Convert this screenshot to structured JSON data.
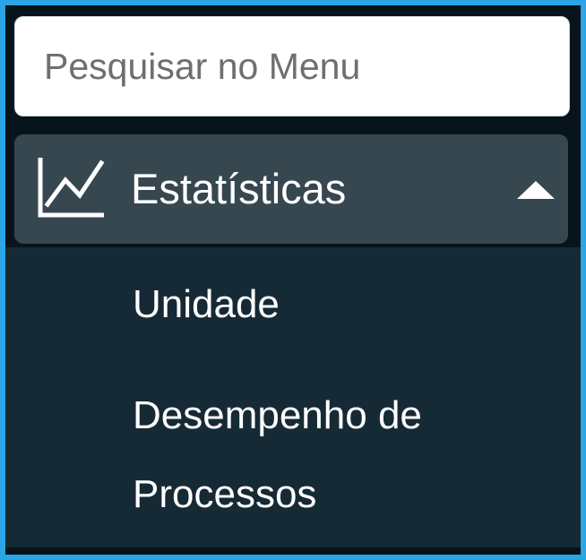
{
  "search": {
    "placeholder": "Pesquisar no Menu"
  },
  "menu": {
    "section": {
      "icon": "line-chart-icon",
      "label": "Estatísticas",
      "expanded": true,
      "toggle_icon": "caret-up-icon"
    },
    "items": [
      {
        "label": "Unidade"
      },
      {
        "label": "Desempenho de Processos"
      }
    ]
  },
  "colors": {
    "frame_border": "#2aa5e6",
    "sidebar_bg": "#162a35",
    "top_bg": "#07141b",
    "section_bg": "#36474f",
    "text": "#ffffff",
    "placeholder": "#6f6f6f"
  }
}
